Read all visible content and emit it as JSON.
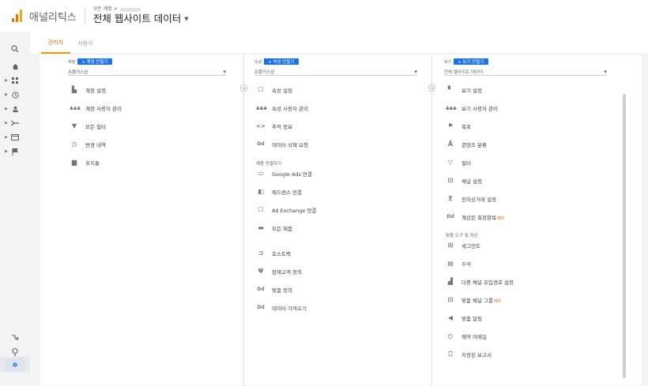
{
  "header": {
    "app_title": "애널리틱스",
    "breadcrumb": "모든 계정 >",
    "view_name": "전체 웹사이트 데이터"
  },
  "colors": {
    "accent": "#1a73e8",
    "tab_active": "#e8710a",
    "logo_bars": [
      "#f9ab00",
      "#e37400",
      "#e37400"
    ]
  },
  "rail": {
    "icons": [
      "search-icon",
      "home-icon",
      "customization-icon",
      "realtime-icon",
      "audience-icon",
      "acquisition-icon",
      "behavior-icon",
      "conversions-icon",
      "attribution-icon",
      "discover-icon",
      "admin-gear-icon"
    ]
  },
  "tabs": [
    {
      "label": "관리자"
    },
    {
      "label": "사용자"
    }
  ],
  "account": {
    "label": "계정",
    "create": "+ 계정 만들기",
    "selector": "유플러스샵",
    "items": [
      {
        "label": "계정 설정",
        "icon": "building-icon"
      },
      {
        "label": "계정 사용자 관리",
        "icon": "users-icon"
      },
      {
        "label": "모든 필터",
        "icon": "filter-icon"
      },
      {
        "label": "변경 내역",
        "icon": "history-icon"
      },
      {
        "label": "휴지통",
        "icon": "trash-icon"
      }
    ]
  },
  "property": {
    "label": "속성",
    "create": "+ 속성 만들기",
    "selector": "유플러스샵",
    "items": [
      {
        "label": "속성 설정",
        "icon": "square-icon"
      },
      {
        "label": "속성 사용자 관리",
        "icon": "users-icon"
      },
      {
        "label": "추적 정보",
        "icon": "code-icon"
      },
      {
        "label": "데이터 삭제 요청",
        "icon": "dd-icon"
      }
    ],
    "section": "제품 연결하기",
    "links": [
      {
        "label": "Google Ads 연결",
        "icon": "ads-icon"
      },
      {
        "label": "애드센스 연결",
        "icon": "adsense-icon"
      },
      {
        "label": "Ad Exchange 연결",
        "icon": "adx-icon"
      },
      {
        "label": "모든 제품",
        "icon": "all-products-icon"
      }
    ],
    "more": [
      {
        "label": "포스트백",
        "icon": "postback-icon"
      },
      {
        "label": "잠재고객 정의",
        "icon": "audience-def-icon"
      },
      {
        "label": "맞춤 정의",
        "icon": "dd-icon"
      },
      {
        "label": "데이터 가져오기",
        "icon": "dd-icon"
      }
    ]
  },
  "view": {
    "label": "보기",
    "create": "+ 보기 만들기",
    "selector": "전체 웹사이트 데이터",
    "items": [
      {
        "label": "보기 설정",
        "icon": "doc-icon"
      },
      {
        "label": "보기 사용자 관리",
        "icon": "users-icon"
      },
      {
        "label": "목표",
        "icon": "flag-icon"
      },
      {
        "label": "콘텐츠 분류",
        "icon": "person-icon"
      },
      {
        "label": "필터",
        "icon": "filter-icon"
      },
      {
        "label": "채널 설정",
        "icon": "channel-icon"
      },
      {
        "label": "전자상거래 설정",
        "icon": "cart-icon"
      },
      {
        "label": "계산된 측정항목",
        "icon": "dd-icon",
        "badge": "베타"
      }
    ],
    "section": "맞춤 도구 및 자산",
    "tools": [
      {
        "label": "세그먼트",
        "icon": "segment-icon"
      },
      {
        "label": "주석",
        "icon": "annotation-icon"
      },
      {
        "label": "다중 채널 유입경로 설정",
        "icon": "bar-chart-icon"
      },
      {
        "label": "맞춤 채널 그룹",
        "icon": "channel-icon",
        "badge": "베타"
      },
      {
        "label": "맞춤 알림",
        "icon": "megaphone-icon"
      },
      {
        "label": "예약 이메일",
        "icon": "clock-icon"
      },
      {
        "label": "저장된 보고서",
        "icon": "saved-report-icon"
      }
    ]
  }
}
